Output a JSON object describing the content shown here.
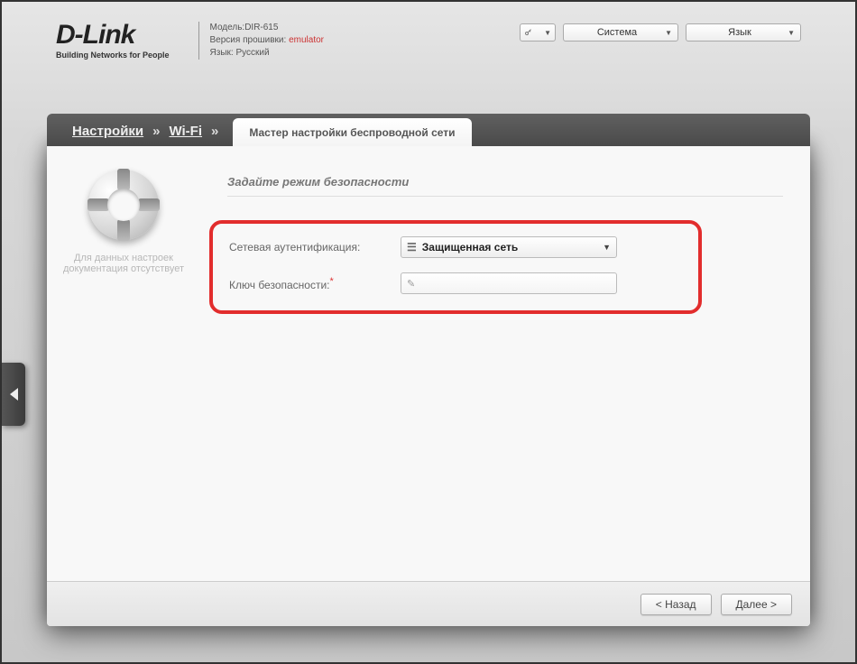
{
  "header": {
    "logo_name": "D-Link",
    "logo_tagline": "Building Networks for People",
    "model_label": "Модель:",
    "model_value": "DIR-615",
    "fw_label": "Версия прошивки:",
    "fw_value": "emulator",
    "lang_label": "Язык:",
    "lang_value": "Русский",
    "dd_system": "Система",
    "dd_language": "Язык"
  },
  "breadcrumb": {
    "root": "Настройки",
    "section": "Wi-Fi",
    "sep": "»"
  },
  "tab": {
    "active": "Мастер настройки беспроводной сети"
  },
  "help": {
    "text": "Для данных настроек документация отсутствует"
  },
  "form": {
    "title": "Задайте режим безопасности",
    "auth_label": "Сетевая аутентификация:",
    "auth_value": "Защищенная сеть",
    "key_label": "Ключ безопасности:",
    "key_value": ""
  },
  "buttons": {
    "back": "< Назад",
    "next": "Далее >"
  }
}
